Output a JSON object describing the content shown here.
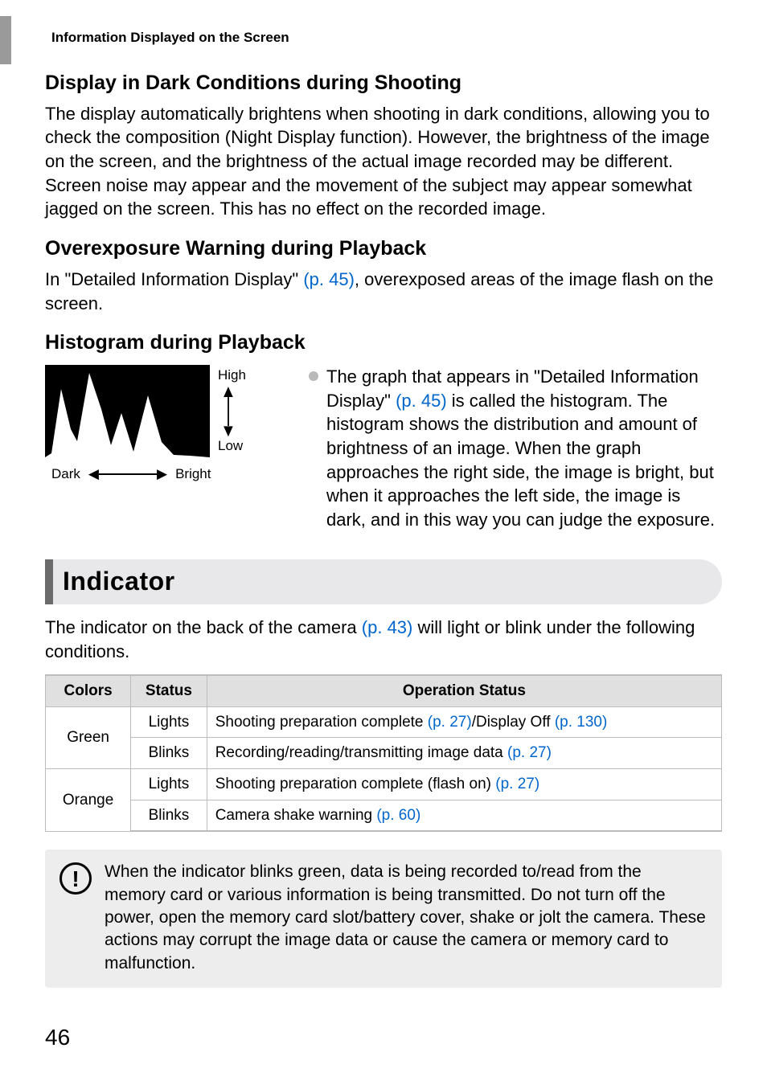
{
  "header": "Information Displayed on the Screen",
  "s1": {
    "title": "Display in Dark Conditions during Shooting",
    "body": "The display automatically brightens when shooting in dark conditions, allowing you to check the composition (Night Display function). However, the brightness of the image on the screen, and the brightness of the actual image recorded may be different. Screen noise may appear and the movement of the subject may appear somewhat jagged on the screen. This has no effect on the recorded image."
  },
  "s2": {
    "title": "Overexposure Warning during Playback",
    "body_a": "In \"Detailed Information Display\" ",
    "link": "(p. 45)",
    "body_b": ", overexposed areas of the image flash on the screen."
  },
  "s3": {
    "title": "Histogram during Playback",
    "labels": {
      "high": "High",
      "low": "Low",
      "dark": "Dark",
      "bright": "Bright"
    },
    "bullet_a": "The graph that appears in \"Detailed Information Display\" ",
    "bullet_link": "(p. 45)",
    "bullet_b": " is called the histogram. The histogram shows the distribution and amount of brightness of an image. When the graph approaches the right side, the image is bright, but when it approaches the left side, the image is dark, and in this way you can judge the exposure."
  },
  "indicator": {
    "title": "Indicator",
    "intro_a": "The indicator on the back of the camera ",
    "intro_link": "(p. 43)",
    "intro_b": " will light or blink under the following conditions.",
    "headers": {
      "colors": "Colors",
      "status": "Status",
      "op": "Operation Status"
    },
    "rows": [
      {
        "color": "Green",
        "r1": {
          "status": "Lights",
          "op_a": "Shooting preparation complete ",
          "op_link1": "(p. 27)",
          "op_mid": "/Display Off ",
          "op_link2": "(p. 130)"
        },
        "r2": {
          "status": "Blinks",
          "op_a": "Recording/reading/transmitting image data ",
          "op_link1": "(p. 27)"
        }
      },
      {
        "color": "Orange",
        "r1": {
          "status": "Lights",
          "op_a": "Shooting preparation complete (flash on) ",
          "op_link1": "(p. 27)"
        },
        "r2": {
          "status": "Blinks",
          "op_a": "Camera shake warning ",
          "op_link1": "(p. 60)"
        }
      }
    ],
    "note": "When the indicator blinks green, data is being recorded to/read from the memory card or various information is being transmitted. Do not turn off the power, open the memory card slot/battery cover, shake or jolt the camera. These actions may corrupt the image data or cause the camera or memory card to malfunction."
  },
  "page_number": "46"
}
